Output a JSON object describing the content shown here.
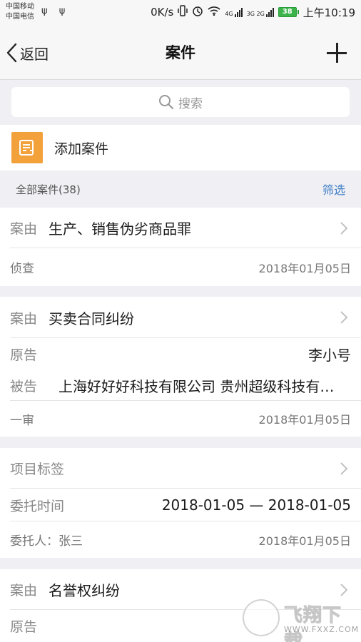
{
  "status_bar": {
    "carrier1": "中国移动",
    "carrier2": "中国电信",
    "usb_icons": "ψ ψ",
    "net_speed": "0K/s",
    "signal1_label": "4G",
    "signal2_label": "3G 2G",
    "battery": "38",
    "time": "上午10:19"
  },
  "nav": {
    "back_label": "返回",
    "title": "案件",
    "add_icon": "plus-icon"
  },
  "search": {
    "placeholder": "搜索"
  },
  "add_case": {
    "label": "添加案件",
    "icon_color": "#f2a13b"
  },
  "section": {
    "title": "全部案件(38)",
    "filter": "筛选"
  },
  "cases": [
    {
      "cause_label": "案由",
      "cause": "生产、销售伪劣商品罪",
      "stage": "侦查",
      "date": "2018年01月05日"
    },
    {
      "cause_label": "案由",
      "cause": "买卖合同纠纷",
      "plaintiff_label": "原告",
      "plaintiff": "李小号",
      "defendant_label": "被告",
      "defendant": "上海好好好科技有限公司  贵州超级科技有…",
      "stage": "一审",
      "date": "2018年01月05日"
    },
    {
      "tag_label": "项目标签",
      "entrust_time_label": "委托时间",
      "entrust_time": "2018-01-05 — 2018-01-05",
      "client": "委托人：张三",
      "date": "2018年01月05日"
    },
    {
      "cause_label": "案由",
      "cause": "名誉权纠纷",
      "plaintiff_label": "原告"
    }
  ],
  "watermark": {
    "text": "飞翔下载",
    "url": "WWW.FXXZ.COM"
  },
  "colors": {
    "accent_blue": "#3f7fc8",
    "background": "#efeff4",
    "battery_green": "#3cb44b"
  }
}
